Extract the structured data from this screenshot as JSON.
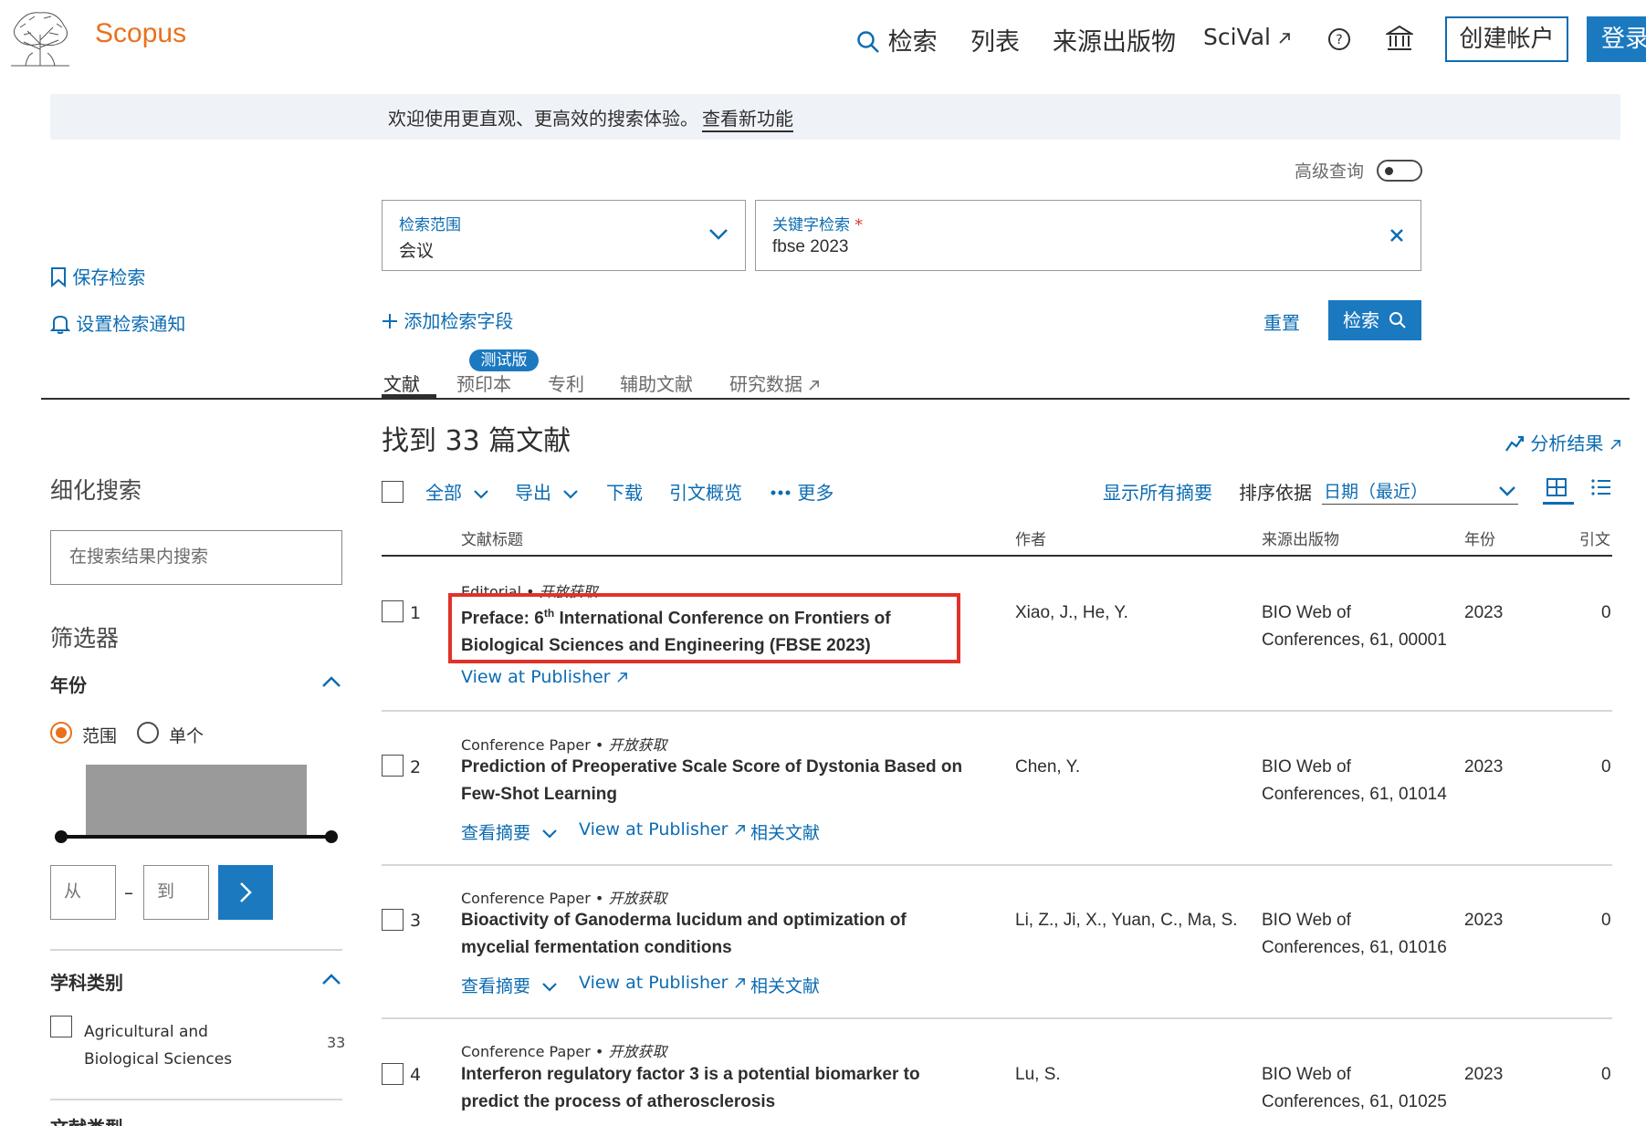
{
  "header": {
    "brand": "Scopus",
    "nav": {
      "search": "检索",
      "lists": "列表",
      "sources": "来源出版物",
      "scival": "SciVal",
      "create_account": "创建帐户",
      "login": "登录"
    }
  },
  "banner": {
    "text": "欢迎使用更直观、更高效的搜索体验。",
    "link": "查看新功能"
  },
  "search": {
    "advanced_label": "高级查询",
    "scope": {
      "label": "检索范围",
      "value": "会议"
    },
    "keyword": {
      "label": "关键字检索",
      "required_mark": "*",
      "value": "fbse 2023"
    },
    "add_field": "添加检索字段",
    "reset": "重置",
    "submit": "检索"
  },
  "sidebar_links": {
    "save_search": "保存检索",
    "set_alert": "设置检索通知"
  },
  "tabs": {
    "items": [
      "文献",
      "预印本",
      "专利",
      "辅助文献",
      "研究数据"
    ],
    "beta_badge": "测试版"
  },
  "results": {
    "found": "找到 33 篇文献",
    "analyze": "分析结果",
    "toolbar": {
      "all": "全部",
      "export": "导出",
      "download": "下载",
      "citation_overview": "引文概览",
      "more": "更多",
      "show_abstracts": "显示所有摘要",
      "sort_label": "排序依据",
      "sort_value": "日期（最近）"
    },
    "columns": {
      "title": "文献标题",
      "authors": "作者",
      "source": "来源出版物",
      "year": "年份",
      "cited": "引文"
    },
    "rows": [
      {
        "num": "1",
        "doc_type": "Editorial",
        "open_access": "开放获取",
        "title_pre": "Preface: 6",
        "title_sup": "th",
        "title_post": " International Conference on Frontiers of Biological Sciences and Engineering (FBSE 2023)",
        "authors": "Xiao, J., He, Y.",
        "source": "BIO Web of Conferences, 61, 00001",
        "year": "2023",
        "cited": "0",
        "view_publisher": "View at Publisher"
      },
      {
        "num": "2",
        "doc_type": "Conference Paper",
        "open_access": "开放获取",
        "title": "Prediction of Preoperative Scale Score of Dystonia Based on Few-Shot Learning",
        "authors": "Chen, Y.",
        "source": "BIO Web of Conferences, 61, 01014",
        "year": "2023",
        "cited": "0",
        "view_abstract": "查看摘要",
        "view_publisher": "View at Publisher",
        "related": "相关文献"
      },
      {
        "num": "3",
        "doc_type": "Conference Paper",
        "open_access": "开放获取",
        "title": "Bioactivity of Ganoderma lucidum and optimization of mycelial fermentation conditions",
        "authors": "Li, Z., Ji, X., Yuan, C., Ma, S.",
        "source": "BIO Web of Conferences, 61, 01016",
        "year": "2023",
        "cited": "0",
        "view_abstract": "查看摘要",
        "view_publisher": "View at Publisher",
        "related": "相关文献"
      },
      {
        "num": "4",
        "doc_type": "Conference Paper",
        "open_access": "开放获取",
        "title": "Interferon regulatory factor 3 is a potential biomarker to predict the process of atherosclerosis",
        "authors": "Lu, S.",
        "source": "BIO Web of Conferences, 61, 01025",
        "year": "2023",
        "cited": "0"
      }
    ]
  },
  "filters": {
    "refine_title": "细化搜索",
    "within_placeholder": "在搜索结果内搜索",
    "filters_title": "筛选器",
    "year": {
      "heading": "年份",
      "range_label": "范围",
      "single_label": "单个",
      "from_placeholder": "从",
      "to_placeholder": "到",
      "dash": "–"
    },
    "subject": {
      "heading": "学科类别",
      "items": [
        {
          "label": "Agricultural and Biological Sciences",
          "count": "33"
        }
      ]
    },
    "doc_type": {
      "heading": "文献类型"
    }
  },
  "colors": {
    "brand_orange": "#e9711c",
    "link_blue": "#0c6cb2",
    "button_blue": "#1b79c0",
    "highlight_red": "#e0322b"
  }
}
